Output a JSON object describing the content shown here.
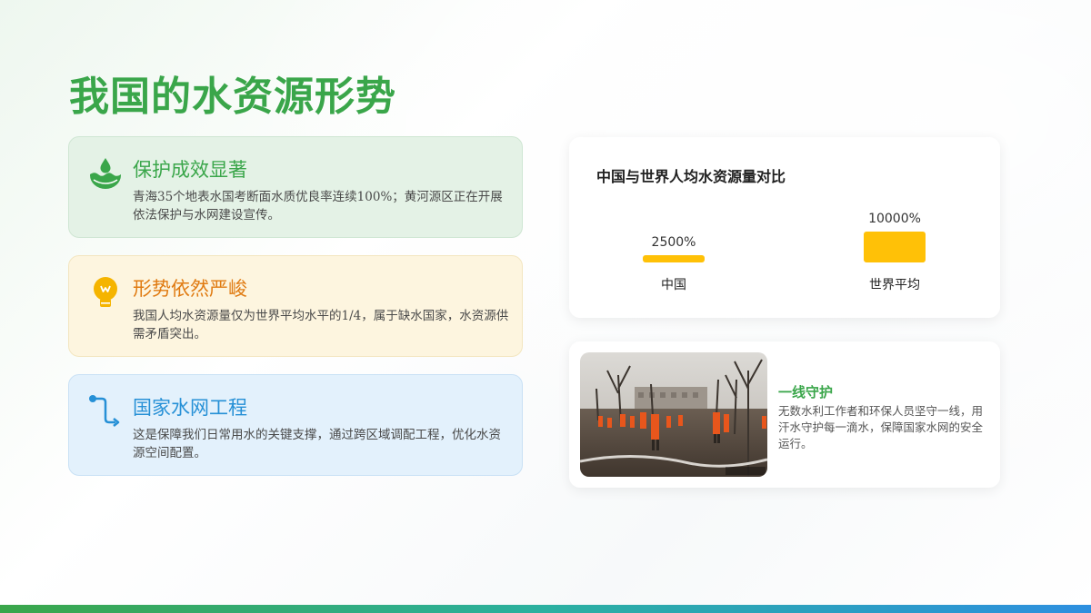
{
  "page": {
    "title": "我国的水资源形势"
  },
  "cards": [
    {
      "title": "保护成效显著",
      "body": "青海35个地表水国考断面水质优良率连续100%；黄河源区正在开展依法保护与水网建设宣传。",
      "icon": "water-drop-icon",
      "accent": "#3aa64a"
    },
    {
      "title": "形势依然严峻",
      "body": "我国人均水资源量仅为世界平均水平的1/4，属于缺水国家，水资源供需矛盾突出。",
      "icon": "lightbulb-icon",
      "accent": "#f5a623"
    },
    {
      "title": "国家水网工程",
      "body": "这是保障我们日常用水的关键支撑，通过跨区域调配工程，优化水资源空间配置。",
      "icon": "route-icon",
      "accent": "#2690d6"
    }
  ],
  "chart_data": {
    "type": "bar",
    "title": "中国与世界人均水资源量对比",
    "categories": [
      "中国",
      "世界平均"
    ],
    "values": [
      2500,
      10000
    ],
    "value_labels": [
      "2500%",
      "10000%"
    ],
    "ylim": [
      0,
      10000
    ],
    "bar_color": "#ffc107",
    "grid": false
  },
  "photo_card": {
    "title": "一线守护",
    "body": "无数水利工作者和环保人员坚守一线，用汗水守护每一滴水，保障国家水网的安全运行。",
    "photo": "workers-in-orange-uniforms-photo"
  },
  "colors": {
    "title_green": "#3aa64a",
    "warning_orange": "#e07b12",
    "info_blue": "#2690d6"
  }
}
